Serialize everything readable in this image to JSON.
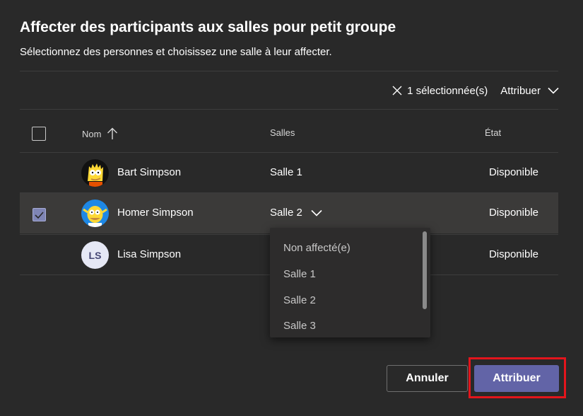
{
  "dialog": {
    "title": "Affecter des participants aux salles pour petit groupe",
    "subtitle": "Sélectionnez des personnes et choisissez une salle à leur affecter."
  },
  "toolbar": {
    "selection_count": "1 sélectionnée(s)",
    "assign_label": "Attribuer"
  },
  "table": {
    "headers": {
      "name": "Nom",
      "rooms": "Salles",
      "state": "État"
    },
    "rows": [
      {
        "name": "Bart Simpson",
        "room": "Salle 1",
        "state": "Disponible",
        "selected": false
      },
      {
        "name": "Homer Simpson",
        "room": "Salle 2",
        "state": "Disponible",
        "selected": true
      },
      {
        "name": "Lisa Simpson",
        "room": "",
        "state": "Disponible",
        "selected": false,
        "initials": "LS"
      }
    ]
  },
  "room_dropdown": {
    "options": [
      "Non affecté(e)",
      "Salle 1",
      "Salle 2",
      "Salle 3"
    ]
  },
  "footer": {
    "cancel_label": "Annuler",
    "assign_label": "Attribuer"
  },
  "colors": {
    "background": "#292929",
    "accent": "#6264a7",
    "selected_row": "#3b3a39",
    "highlight": "#e3151c"
  }
}
